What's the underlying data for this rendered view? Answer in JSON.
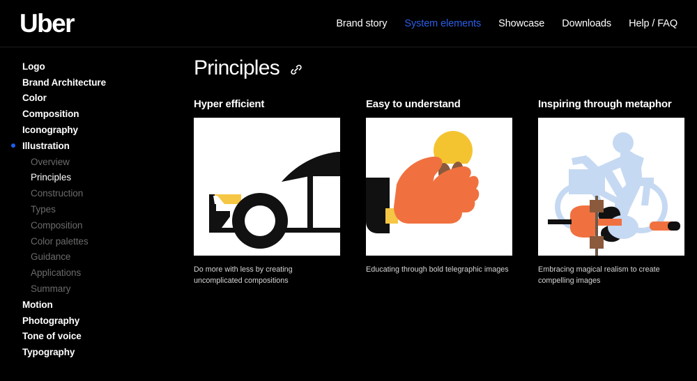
{
  "header": {
    "logo": "Uber",
    "nav": [
      {
        "label": "Brand story",
        "active": false
      },
      {
        "label": "System elements",
        "active": true
      },
      {
        "label": "Showcase",
        "active": false
      },
      {
        "label": "Downloads",
        "active": false
      },
      {
        "label": "Help / FAQ",
        "active": false
      }
    ]
  },
  "sidebar": {
    "items": [
      {
        "label": "Logo",
        "level": "top"
      },
      {
        "label": "Brand Architecture",
        "level": "top"
      },
      {
        "label": "Color",
        "level": "top"
      },
      {
        "label": "Composition",
        "level": "top"
      },
      {
        "label": "Iconography",
        "level": "top"
      },
      {
        "label": "Illustration",
        "level": "top",
        "active": true
      },
      {
        "label": "Overview",
        "level": "sub"
      },
      {
        "label": "Principles",
        "level": "sub",
        "current": true
      },
      {
        "label": "Construction",
        "level": "sub"
      },
      {
        "label": "Types",
        "level": "sub"
      },
      {
        "label": "Composition",
        "level": "sub"
      },
      {
        "label": "Color palettes",
        "level": "sub"
      },
      {
        "label": "Guidance",
        "level": "sub"
      },
      {
        "label": "Applications",
        "level": "sub"
      },
      {
        "label": "Summary",
        "level": "sub"
      },
      {
        "label": "Motion",
        "level": "top"
      },
      {
        "label": "Photography",
        "level": "top"
      },
      {
        "label": "Tone of voice",
        "level": "top"
      },
      {
        "label": "Typography",
        "level": "top"
      }
    ]
  },
  "main": {
    "page_title": "Principles",
    "anchor_icon": "link-icon",
    "cards": [
      {
        "heading": "Hyper efficient",
        "caption": "Do more with less by creating uncomplicated compositions",
        "illustration": "car-line-art-illustration"
      },
      {
        "heading": "Easy to understand",
        "caption": "Educating through bold telegraphic images",
        "illustration": "hand-holding-food-illustration"
      },
      {
        "heading": "Inspiring through metaphor",
        "caption": "Embracing magical realism to create compelling images",
        "illustration": "cyclist-hummingbird-illustration"
      }
    ]
  },
  "colors": {
    "background": "#000000",
    "accent_blue": "#2b5fe8",
    "illustration_yellow": "#F6C645",
    "illustration_orange": "#F0713F",
    "illustration_blue": "#C6D9F2",
    "illustration_brown": "#8B5A3C",
    "text_muted": "#6b6b6b"
  }
}
